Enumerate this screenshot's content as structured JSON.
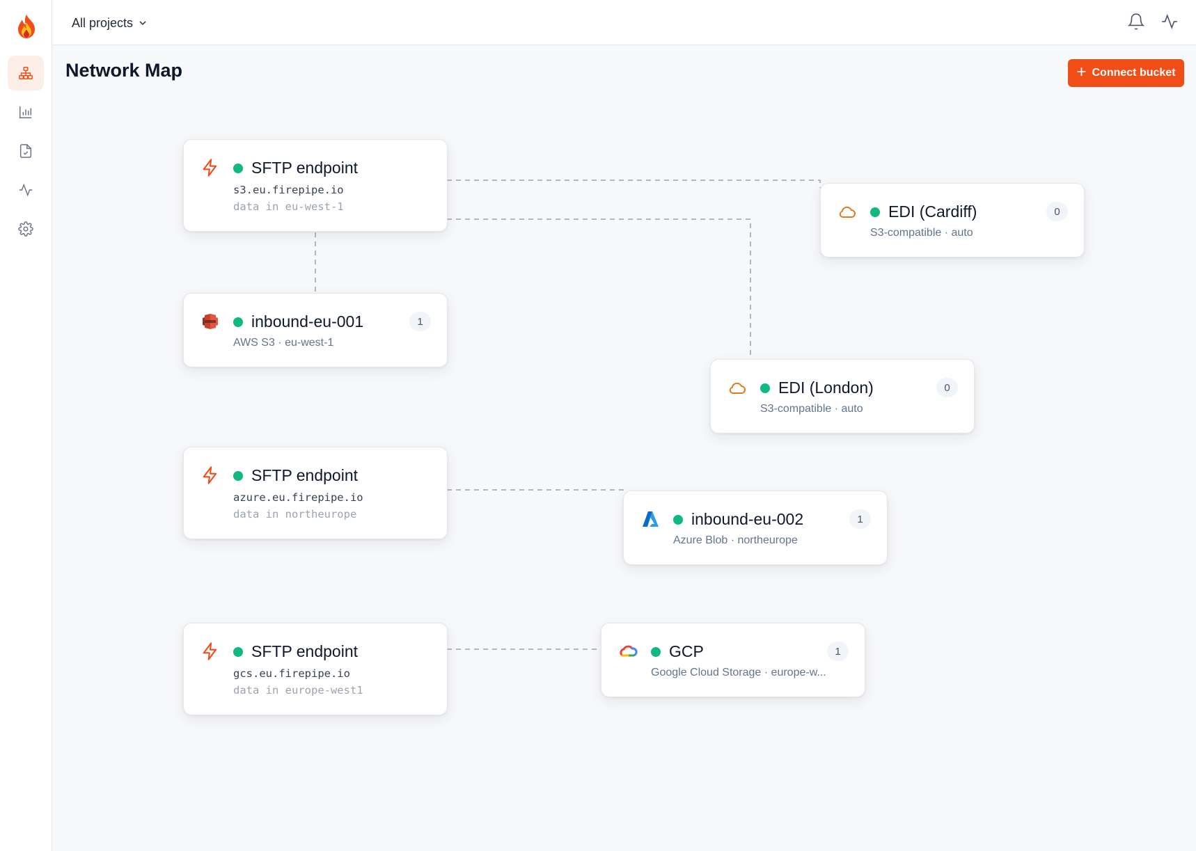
{
  "header": {
    "project_selector": "All projects",
    "page_title": "Network Map",
    "connect_button": "Connect bucket"
  },
  "sidebar": {
    "items": [
      {
        "name": "network-map",
        "icon": "sitemap-icon",
        "active": true
      },
      {
        "name": "analytics",
        "icon": "bar-chart-icon",
        "active": false
      },
      {
        "name": "documents",
        "icon": "file-check-icon",
        "active": false
      },
      {
        "name": "activity",
        "icon": "activity-icon",
        "active": false
      },
      {
        "name": "settings",
        "icon": "gear-icon",
        "active": false
      }
    ]
  },
  "top_icons": [
    "bell-icon",
    "activity-icon"
  ],
  "colors": {
    "accent": "#f04d17",
    "status_ok": "#10b981",
    "connector": "#9ca3af"
  },
  "nodes": {
    "sftp1": {
      "icon": "lightning-icon",
      "title": "SFTP endpoint",
      "host": "s3.eu.firepipe.io",
      "region": "data in eu-west-1"
    },
    "sftp2": {
      "icon": "lightning-icon",
      "title": "SFTP endpoint",
      "host": "azure.eu.firepipe.io",
      "region": "data in northeurope"
    },
    "sftp3": {
      "icon": "lightning-icon",
      "title": "SFTP endpoint",
      "host": "gcs.eu.firepipe.io",
      "region": "data in europe-west1"
    },
    "inbound1": {
      "icon": "aws-s3-icon",
      "title": "inbound-eu-001",
      "subtitle": "AWS S3 · eu-west-1",
      "count": "1"
    },
    "edi_cardiff": {
      "icon": "cloud-icon",
      "title": "EDI (Cardiff)",
      "subtitle": "S3-compatible · auto",
      "count": "0"
    },
    "edi_london": {
      "icon": "cloud-icon",
      "title": "EDI (London)",
      "subtitle": "S3-compatible · auto",
      "count": "0"
    },
    "inbound2": {
      "icon": "azure-icon",
      "title": "inbound-eu-002",
      "subtitle": "Azure Blob · northeurope",
      "count": "1"
    },
    "gcp": {
      "icon": "google-cloud-icon",
      "title": "GCP",
      "subtitle": "Google Cloud Storage · europe-w...",
      "count": "1"
    }
  }
}
